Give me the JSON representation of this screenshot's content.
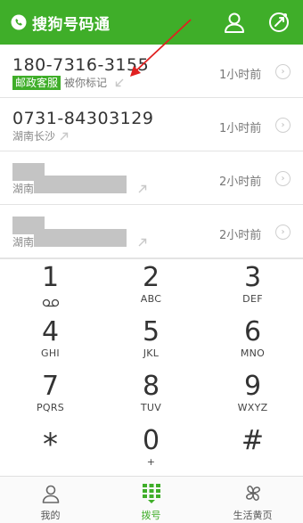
{
  "header": {
    "title": "搜狗号码通",
    "logo_icon": "phone-logo-icon",
    "profile_icon": "person-icon",
    "dial_icon": "circle-dial-icon",
    "color": "#3fae29"
  },
  "calls": [
    {
      "number": "180-7316-3155",
      "tag": "邮政客服",
      "mark": "被你标记",
      "location": "",
      "time": "1小时前",
      "direction_icon": "incoming-arrow-icon",
      "redacted": false
    },
    {
      "number": "0731-84303129",
      "tag": "",
      "mark": "",
      "location": "湖南长沙",
      "time": "1小时前",
      "direction_icon": "outgoing-arrow-icon",
      "redacted": false
    },
    {
      "number": "",
      "tag": "",
      "mark": "",
      "location": "湖南",
      "time": "2小时前",
      "direction_icon": "outgoing-arrow-icon",
      "redacted": true
    },
    {
      "number": "",
      "tag": "",
      "mark": "",
      "location": "湖南",
      "time": "2小时前",
      "direction_icon": "outgoing-arrow-icon",
      "redacted": true
    }
  ],
  "keypad": [
    {
      "digit": "1",
      "letters": ""
    },
    {
      "digit": "2",
      "letters": "ABC"
    },
    {
      "digit": "3",
      "letters": "DEF"
    },
    {
      "digit": "4",
      "letters": "GHI"
    },
    {
      "digit": "5",
      "letters": "JKL"
    },
    {
      "digit": "6",
      "letters": "MNO"
    },
    {
      "digit": "7",
      "letters": "PQRS"
    },
    {
      "digit": "8",
      "letters": "TUV"
    },
    {
      "digit": "9",
      "letters": "WXYZ"
    },
    {
      "digit": "*",
      "letters": ""
    },
    {
      "digit": "0",
      "letters": "+"
    },
    {
      "digit": "#",
      "letters": ""
    }
  ],
  "nav": [
    {
      "label": "我的",
      "icon": "person-outline-icon"
    },
    {
      "label": "拨号",
      "icon": "dialpad-icon",
      "active": true
    },
    {
      "label": "生活黄页",
      "icon": "clover-icon"
    }
  ],
  "colors": {
    "accent": "#3fae29",
    "annotation_arrow": "#e02020",
    "redaction": "#c4c4c4"
  }
}
